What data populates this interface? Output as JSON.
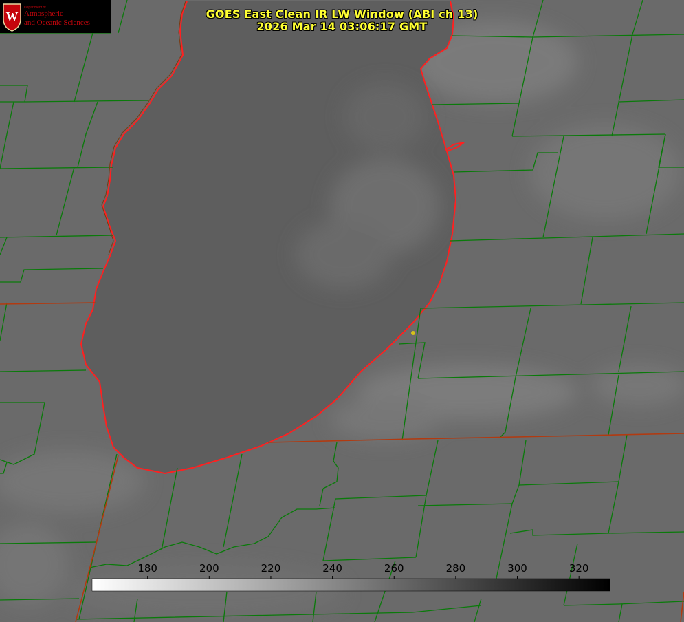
{
  "title": {
    "line1": "GOES East Clean IR LW Window (ABI ch 13)",
    "line2": "2026 Mar 14 03:06:17 GMT"
  },
  "logo": {
    "department": "Department of",
    "name_line1": "Atmospheric",
    "name_line2": "and Oceanic Sciences",
    "shield_letter": "W"
  },
  "colorbar": {
    "ticks": [
      180,
      200,
      220,
      240,
      260,
      280,
      300,
      320
    ],
    "min": 162,
    "max": 330,
    "color_low": "#ffffff",
    "color_high": "#000000"
  },
  "colors": {
    "county_lines": "#0a7a0a",
    "state_lines": "#b23a10",
    "lake_outline": "#ff2020",
    "title_text": "#ffff33",
    "marker": "#d6c21a",
    "logo_red": "#c5050c"
  },
  "icons": {
    "marker": "station-dot-icon",
    "shield": "uw-crest-icon"
  }
}
